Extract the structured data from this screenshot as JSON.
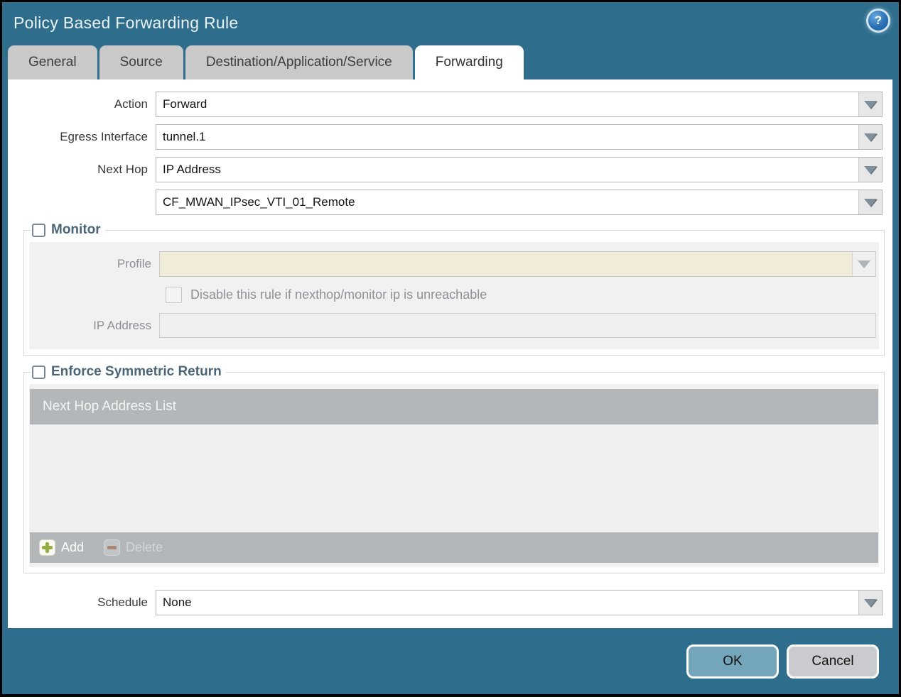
{
  "window": {
    "title": "Policy Based Forwarding Rule"
  },
  "tabs": [
    {
      "label": "General"
    },
    {
      "label": "Source"
    },
    {
      "label": "Destination/Application/Service"
    },
    {
      "label": "Forwarding"
    }
  ],
  "form": {
    "action_label": "Action",
    "action_value": "Forward",
    "egress_label": "Egress Interface",
    "egress_value": "tunnel.1",
    "next_hop_label": "Next Hop",
    "next_hop_value": "IP Address",
    "next_hop_address_value": "CF_MWAN_IPsec_VTI_01_Remote",
    "schedule_label": "Schedule",
    "schedule_value": "None"
  },
  "monitor": {
    "title": "Monitor",
    "profile_label": "Profile",
    "profile_value": "",
    "disable_rule_label": "Disable this rule if nexthop/monitor ip is unreachable",
    "ip_address_label": "IP Address",
    "ip_address_value": ""
  },
  "symmetric_return": {
    "title": "Enforce Symmetric Return",
    "list_header": "Next Hop Address List",
    "add_label": "Add",
    "delete_label": "Delete"
  },
  "footer": {
    "ok_label": "OK",
    "cancel_label": "Cancel"
  },
  "icons": {
    "help_glyph": "?"
  },
  "colors": {
    "titlebar_teal": "#2f6d8c",
    "tab_inactive": "#c9c9c9",
    "tab_active": "#ffffff",
    "section_title": "#4a6577",
    "disabled_field_beige": "#f1ecd9",
    "table_bar_gray": "#b3b7b9",
    "add_icon_green": "#94ac44",
    "ok_button_blue": "#73a6bb",
    "cancel_button_gray": "#cacbce"
  }
}
